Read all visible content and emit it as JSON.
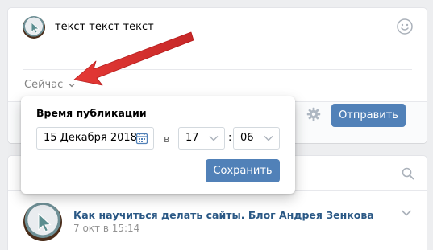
{
  "composer": {
    "text": "текст текст текст",
    "now_label": "Сейчас",
    "send_label": "Отправить"
  },
  "publish_popup": {
    "title": "Время публикации",
    "date": "15 Декабря 2018",
    "in_label": "в",
    "hour": "17",
    "colon": ":",
    "minute": "06",
    "save_label": "Сохранить"
  },
  "feed": {
    "post_title": "Как научиться делать сайты. Блог Андрея Зенкова",
    "post_date": "7 окт в 15:14"
  },
  "colors": {
    "accent": "#5181b8",
    "link": "#2a5885",
    "annotation_arrow": "#e53935"
  },
  "icons": [
    "avatar-cursor-icon",
    "smile-icon",
    "chevron-down-icon",
    "gear-icon",
    "calendar-icon",
    "search-icon"
  ]
}
